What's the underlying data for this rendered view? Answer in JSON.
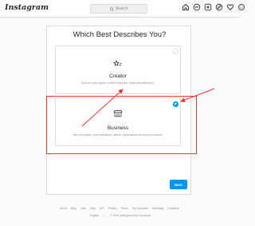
{
  "app": {
    "logo": "Instagram",
    "search_placeholder": "Search",
    "nav_icons": [
      "home-icon",
      "messenger-icon",
      "new-post-icon",
      "explore-icon",
      "activity-heart-icon",
      "profile-avatar-icon"
    ]
  },
  "page": {
    "title": "Which Best Describes You?",
    "options": [
      {
        "name": "Creator",
        "description": "Best for public figures, content producers, artists and influencers.",
        "icon": "creator-star-icon",
        "selected": false
      },
      {
        "name": "Business",
        "description": "Best for retailers, local businesses, brands, organizations and service providers.",
        "icon": "business-store-icon",
        "selected": true
      }
    ],
    "next_label": "Next"
  },
  "annotation": {
    "color": "#e53935"
  },
  "colors": {
    "accent": "#0095f6",
    "border": "#dbdbdb",
    "muted_text": "#8e8e8e"
  },
  "footer": {
    "links": [
      "About",
      "Blog",
      "Jobs",
      "Help",
      "API",
      "Privacy",
      "Terms",
      "Top Accounts",
      "Hashtags",
      "Locations"
    ],
    "language": "English",
    "language_chevron": "⌄",
    "copyright": "© 2021 Instagram from Facebook"
  }
}
